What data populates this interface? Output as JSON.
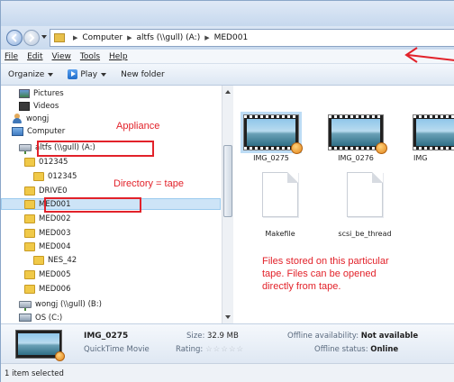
{
  "address": {
    "crumbs": [
      "Computer",
      "altfs (\\\\gull) (A:)",
      "MED001"
    ]
  },
  "menu": {
    "items": [
      "File",
      "Edit",
      "View",
      "Tools",
      "Help"
    ]
  },
  "toolbar": {
    "organize": "Organize",
    "play": "Play",
    "new_folder": "New folder"
  },
  "tree": {
    "items": [
      {
        "label": "Pictures",
        "icon": "pictures-icon"
      },
      {
        "label": "Videos",
        "icon": "videos-icon"
      },
      {
        "label": "wongj",
        "icon": "user-icon"
      },
      {
        "label": "Computer",
        "icon": "computer-icon"
      },
      {
        "label": "altfs (\\\\gull) (A:)",
        "icon": "network-drive-icon"
      },
      {
        "label": "012345",
        "icon": "folder-icon"
      },
      {
        "label": "012345",
        "icon": "folder-icon"
      },
      {
        "label": "DRIVE0",
        "icon": "folder-icon"
      },
      {
        "label": "MED001",
        "icon": "folder-icon"
      },
      {
        "label": "MED002",
        "icon": "folder-icon"
      },
      {
        "label": "MED003",
        "icon": "folder-icon"
      },
      {
        "label": "MED004",
        "icon": "folder-icon"
      },
      {
        "label": "NES_42",
        "icon": "folder-icon"
      },
      {
        "label": "MED005",
        "icon": "folder-icon"
      },
      {
        "label": "MED006",
        "icon": "folder-icon"
      },
      {
        "label": "wongj (\\\\gull) (B:)",
        "icon": "network-drive-icon"
      },
      {
        "label": "OS (C:)",
        "icon": "os-drive-icon"
      }
    ]
  },
  "annotations": {
    "appliance": "Appliance",
    "directory": "Directory = tape",
    "files_note": "Files stored on this particular tape. Files can be opened directly from tape.",
    "files_line1": "Files stored on this particular",
    "files_line2": "tape. Files can be opened",
    "files_line3": "directly from tape.",
    "color": "#e2222a"
  },
  "files": [
    {
      "name": "IMG_0275",
      "type": "video"
    },
    {
      "name": "IMG_0276",
      "type": "video"
    },
    {
      "name": "IMG",
      "type": "video"
    },
    {
      "name": "Makefile",
      "type": "document"
    },
    {
      "name": "scsi_be_thread",
      "type": "document"
    }
  ],
  "details": {
    "name": "IMG_0275",
    "type": "QuickTime Movie",
    "size_label": "Size:",
    "size_value": "32.9 MB",
    "rating_label": "Rating:",
    "rating_stars": "☆☆☆☆☆",
    "availability_label": "Offline availability:",
    "availability_value": "Not available",
    "status_label": "Offline status:",
    "status_value": "Online"
  },
  "status": {
    "text": "1 item selected"
  }
}
